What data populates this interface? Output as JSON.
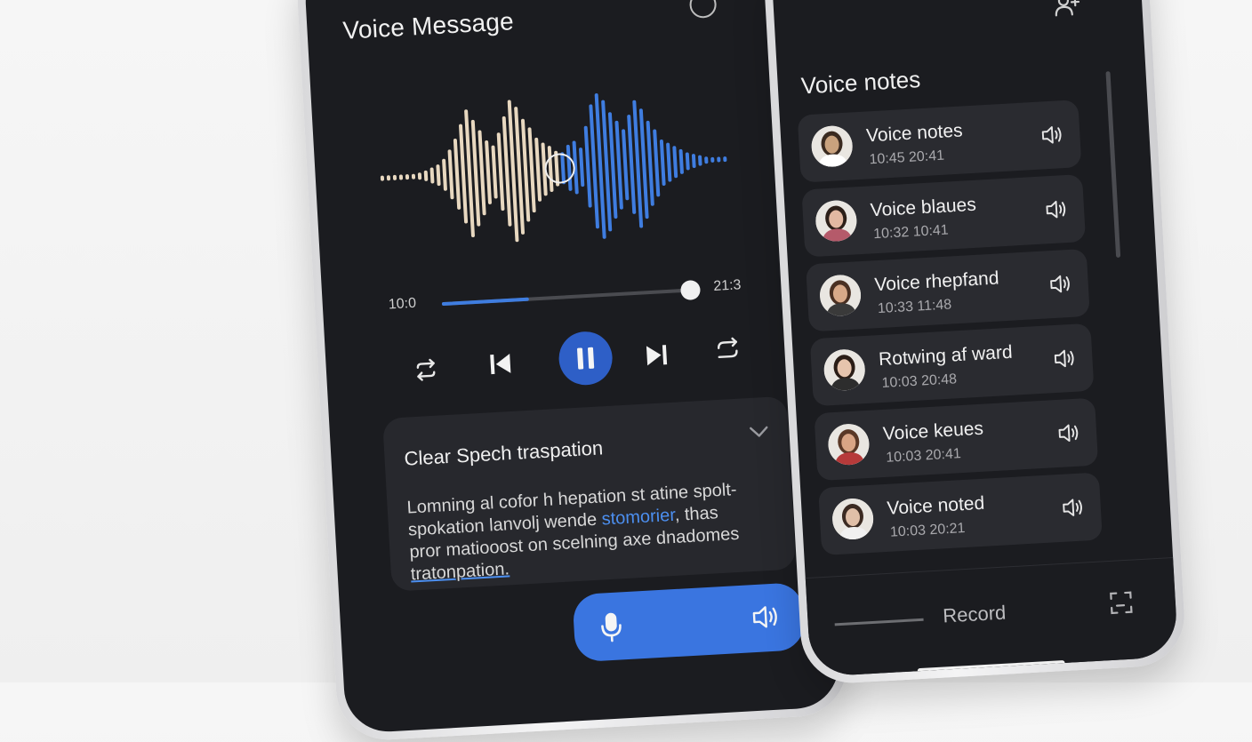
{
  "player": {
    "title": "Voice Message",
    "time_current": "10:0",
    "time_total": "21:3",
    "progress": 0.35
  },
  "transcript": {
    "title": "Clear Spech traspation",
    "line1": "Lomning al cofor h hepation st atine spolt-",
    "line2a": "spokation  lanvolj wende ",
    "line2_highlight": "stomorier",
    "line2b": ", thas",
    "line3": "pror matiooost on scelning axe dnadomes",
    "line4": "tratonpation."
  },
  "list": {
    "title": "Voice notes",
    "items": [
      {
        "name": "Voice notes",
        "time": "10:45 20:41"
      },
      {
        "name": "Voice blaues",
        "time": "10:32 10:41"
      },
      {
        "name": "Voice rhepfand",
        "time": "10:33 11:48"
      },
      {
        "name": "Rotwing af ward",
        "time": "10:03 20:48"
      },
      {
        "name": "Voice keues",
        "time": "10:03 20:41"
      },
      {
        "name": "Voice noted",
        "time": "10:03 20:21"
      }
    ],
    "record_label": "Record"
  },
  "colors": {
    "accent": "#3a75e0",
    "wave_played": "#e8d8c0",
    "wave_unplayed": "#3f7de0",
    "screen_bg": "#1b1c20"
  },
  "icons": [
    "info-icon",
    "repeat-icon",
    "skip-back-icon",
    "pause-icon",
    "skip-forward-icon",
    "loop-icon",
    "chevron-down-icon",
    "mic-icon",
    "speaker-icon",
    "add-person-icon",
    "record-frame-icon"
  ]
}
